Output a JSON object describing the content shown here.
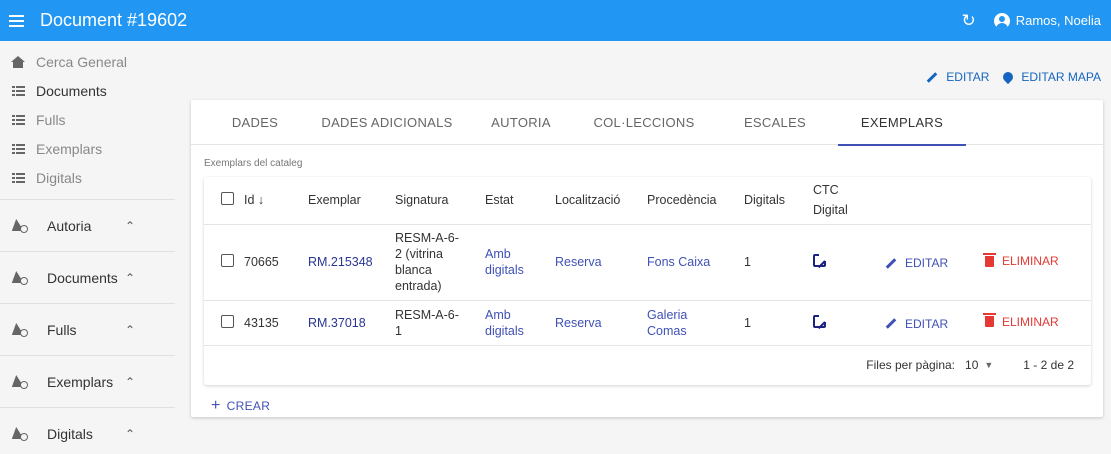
{
  "header": {
    "title": "Document #19602",
    "user": "Ramos, Noelia"
  },
  "sidebar": {
    "items": [
      {
        "label": "Cerca General",
        "icon": "home-icon"
      },
      {
        "label": "Documents",
        "icon": "list-icon"
      },
      {
        "label": "Fulls",
        "icon": "list-icon"
      },
      {
        "label": "Exemplars",
        "icon": "list-icon"
      },
      {
        "label": "Digitals",
        "icon": "list-icon"
      }
    ],
    "groups": [
      "Autoria",
      "Documents",
      "Fulls",
      "Exemplars",
      "Digitals"
    ]
  },
  "actions": {
    "edit": "EDITAR",
    "edit_map": "EDITAR MAPA"
  },
  "tabs": [
    "DADES",
    "DADES ADICIONALS",
    "AUTORIA",
    "COL·LECCIONS",
    "ESCALES",
    "EXEMPLARS"
  ],
  "active_tab": "EXEMPLARS",
  "section": {
    "subtitle": "Exemplars del cataleg"
  },
  "table": {
    "headers": {
      "id": "Id",
      "exemplar": "Exemplar",
      "signatura": "Signatura",
      "estat": "Estat",
      "localitzacio": "Localització",
      "procedencia": "Procedència",
      "digitals": "Digitals",
      "ctc_1": "CTC",
      "ctc_2": "Digital"
    },
    "rows": [
      {
        "id": "70665",
        "exemplar": "RM.215348",
        "signatura_lines": [
          "RESM-A-6-",
          "2 (vitrina",
          "blanca",
          "entrada)"
        ],
        "estat_lines": [
          "Amb",
          "digitals"
        ],
        "localitzacio": "Reserva",
        "procedencia_lines": [
          "Fons Caixa"
        ],
        "digitals": "1",
        "edit": "EDITAR",
        "delete": "ELIMINAR"
      },
      {
        "id": "43135",
        "exemplar": "RM.37018",
        "signatura_lines": [
          "RESM-A-6-",
          "1"
        ],
        "estat_lines": [
          "Amb",
          "digitals"
        ],
        "localitzacio": "Reserva",
        "procedencia_lines": [
          "Galeria",
          "Comas"
        ],
        "digitals": "1",
        "edit": "EDITAR",
        "delete": "ELIMINAR"
      }
    ]
  },
  "pagination": {
    "label": "Files per pàgina:",
    "per_page": "10",
    "range": "1 - 2 de 2"
  },
  "create_label": "CREAR",
  "colors": {
    "primary": "#2196f3",
    "accent": "#3f51b5",
    "danger": "#e53935"
  }
}
